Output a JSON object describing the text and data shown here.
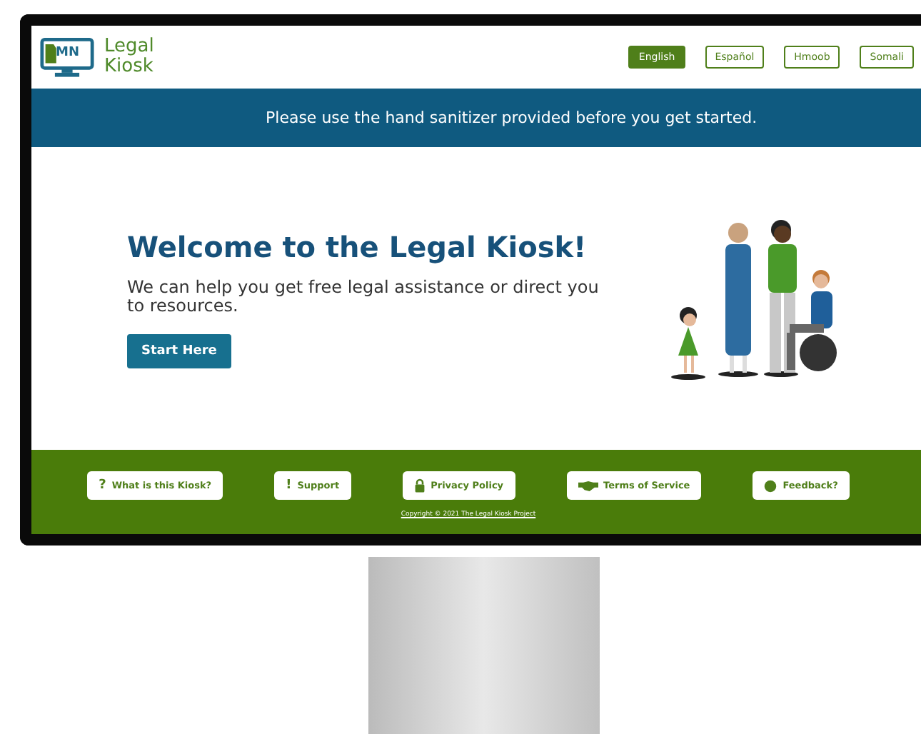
{
  "header": {
    "logo_mark": "MN",
    "logo_text": [
      "Legal",
      "Kiosk"
    ]
  },
  "languages": [
    {
      "label": "English",
      "selected": true
    },
    {
      "label": "Español",
      "selected": false
    },
    {
      "label": "Hmoob",
      "selected": false
    },
    {
      "label": "Somali",
      "selected": false
    }
  ],
  "banner": "Please use the hand sanitizer provided before you get started.",
  "hero": {
    "title": "Welcome to the Legal Kiosk!",
    "subtitle": "We can help you get free legal assistance or direct you to resources.",
    "button": "Start Here"
  },
  "footer": {
    "links": [
      {
        "kind": "glyph",
        "glyph": "?",
        "label": "What is this Kiosk?"
      },
      {
        "kind": "glyph",
        "glyph": "!",
        "label": "Support"
      },
      {
        "kind": "lock",
        "label": "Privacy Policy"
      },
      {
        "kind": "handshake",
        "label": "Terms of Service"
      },
      {
        "kind": "chat",
        "label": "Feedback?"
      }
    ],
    "copyright": "Copyright © 2021 The Legal Kiosk Project"
  }
}
